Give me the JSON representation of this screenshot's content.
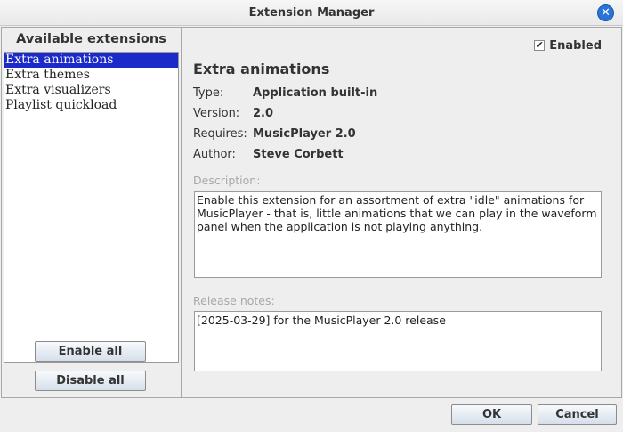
{
  "window": {
    "title": "Extension Manager",
    "close_glyph": "✕"
  },
  "sidebar": {
    "header": "Available extensions",
    "items": [
      {
        "label": "Extra animations",
        "selected": true
      },
      {
        "label": "Extra themes",
        "selected": false
      },
      {
        "label": "Extra visualizers",
        "selected": false
      },
      {
        "label": "Playlist quickload",
        "selected": false
      }
    ],
    "enable_all_label": "Enable all",
    "disable_all_label": "Disable all"
  },
  "details": {
    "enabled_checked": true,
    "enabled_check_glyph": "✔",
    "enabled_label": "Enabled",
    "title": "Extra animations",
    "fields": {
      "type_label": "Type:",
      "type_value": "Application built-in",
      "version_label": "Version:",
      "version_value": "2.0",
      "requires_label": "Requires:",
      "requires_value": "MusicPlayer 2.0",
      "author_label": "Author:",
      "author_value": "Steve Corbett"
    },
    "description_label": "Description:",
    "description_text": "Enable this extension for an assortment of extra \"idle\" animations for\nMusicPlayer - that is, little animations that we can play in the waveform\npanel when the application is not playing anything.",
    "release_notes_label": "Release notes:",
    "release_notes_text": "[2025-03-29] for the MusicPlayer 2.0 release"
  },
  "footer": {
    "ok_label": "OK",
    "cancel_label": "Cancel"
  },
  "colors": {
    "selection": "#1b2ac8",
    "close_button": "#2a74d8",
    "window_bg": "#eeeeee"
  }
}
